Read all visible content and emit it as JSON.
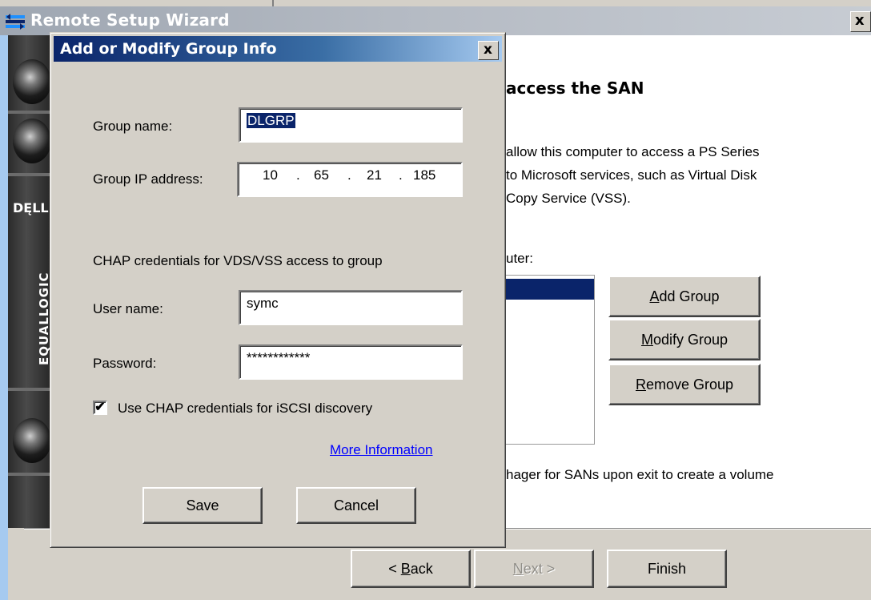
{
  "wizard": {
    "title": "Remote Setup Wizard",
    "close_label": "x",
    "brand": {
      "logo": "DĘLL",
      "product": "EQUALLOGIC"
    },
    "heading": "access the SAN",
    "description_lines": [
      "allow this computer to access a PS Series",
      "to Microsoft services, such as Virtual Disk",
      "Copy Service (VSS)."
    ],
    "computer_label": "uter:",
    "group_buttons": {
      "add": {
        "mnemonic": "A",
        "rest": "dd Group"
      },
      "modify": {
        "mnemonic": "M",
        "rest": "odify Group"
      },
      "remove": {
        "mnemonic": "R",
        "rest": "emove Group"
      }
    },
    "exit_note": "hager for SANs upon exit to create a volume",
    "nav": {
      "back": {
        "prefix": "< ",
        "mnemonic": "B",
        "rest": "ack"
      },
      "next": {
        "mnemonic": "N",
        "rest": "ext >"
      },
      "finish": "Finish"
    }
  },
  "dialog": {
    "title": "Add or Modify Group Info",
    "close_label": "x",
    "group_name_label": "Group name:",
    "group_name_value": "DLGRP",
    "group_ip_label": "Group IP address:",
    "group_ip_octets": [
      "10",
      "65",
      "21",
      "185"
    ],
    "ip_separator": ".",
    "chap_section_label": "CHAP credentials for VDS/VSS access to group",
    "user_name_label": "User name:",
    "user_name_value": "symc",
    "password_label": "Password:",
    "password_value": "************",
    "use_chap_checkbox_label": "Use CHAP credentials for iSCSI discovery",
    "use_chap_checked": true,
    "checkmark": "✔",
    "more_info_link": "More Information",
    "save_label": "Save",
    "cancel_label": "Cancel"
  },
  "colors": {
    "desktop": "#a6caf0",
    "face": "#d4d0c8",
    "active_title": "#0a246a",
    "selection": "#0a246a",
    "link": "#0000ff"
  }
}
